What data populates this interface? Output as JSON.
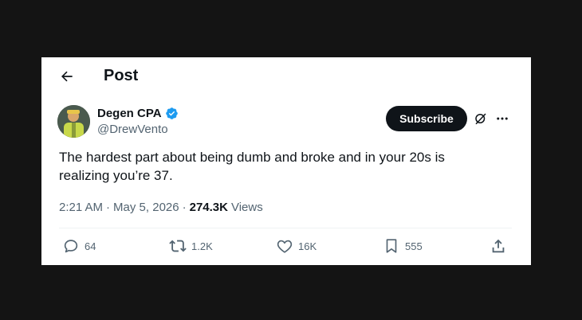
{
  "header": {
    "title": "Post"
  },
  "author": {
    "display_name": "Degen CPA",
    "handle": "@DrewVento",
    "verified_color": "#1d9bf0"
  },
  "subscribe_label": "Subscribe",
  "tweet": {
    "line1": "The hardest part about being dumb and broke and in your 20s is",
    "line2": "realizing you’re 37."
  },
  "meta": {
    "time": "2:21 AM",
    "sep1": "·",
    "date": "May 5, 2026",
    "sep2": "·",
    "views_count": "274.3K",
    "views_label": "Views"
  },
  "actions": {
    "replies": "64",
    "reposts": "1.2K",
    "likes": "16K",
    "bookmarks": "555"
  },
  "icons": [
    "back-arrow-icon",
    "verified-badge-icon",
    "grok-icon",
    "more-icon",
    "reply-icon",
    "repost-icon",
    "like-icon",
    "bookmark-icon",
    "share-icon"
  ]
}
